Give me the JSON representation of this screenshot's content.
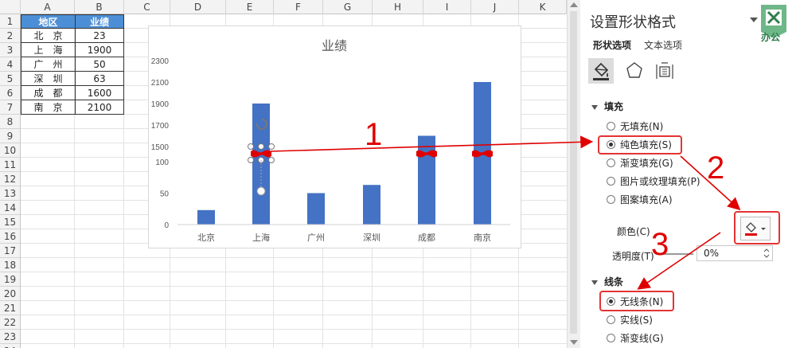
{
  "sheet": {
    "columns": [
      "A",
      "B",
      "C",
      "D",
      "E",
      "F",
      "G",
      "H",
      "I",
      "J",
      "K"
    ],
    "rows": [
      "1",
      "2",
      "3",
      "4",
      "5",
      "6",
      "7",
      "8",
      "9",
      "10",
      "11",
      "12",
      "13",
      "14",
      "15",
      "16",
      "17",
      "18",
      "19",
      "20",
      "21",
      "22",
      "23",
      "24"
    ],
    "table": {
      "headers": [
        "地区",
        "业绩"
      ],
      "rows": [
        [
          "北　京",
          "23"
        ],
        [
          "上　海",
          "1900"
        ],
        [
          "广　州",
          "50"
        ],
        [
          "深　圳",
          "63"
        ],
        [
          "成　都",
          "1600"
        ],
        [
          "南　京",
          "2100"
        ]
      ]
    }
  },
  "chart_data": {
    "type": "bar",
    "title": "业绩",
    "categories": [
      "北京",
      "上海",
      "广州",
      "深圳",
      "成都",
      "南京"
    ],
    "values": [
      23,
      1900,
      50,
      63,
      1600,
      2100
    ],
    "ytick_labels_upper": [
      "1500",
      "1700",
      "1900",
      "2100",
      "2300"
    ],
    "ytick_labels_lower": [
      "0",
      "50",
      "100"
    ],
    "axis_break": "100-1500",
    "bar_color": "#4472c4",
    "break_marker_color": "#e00000",
    "grid": false
  },
  "panel": {
    "title": "设置形状格式",
    "tabs": [
      "形状选项",
      "文本选项"
    ],
    "fill_section": "填充",
    "fill_options": [
      "无填充(N)",
      "纯色填充(S)",
      "渐变填充(G)",
      "图片或纹理填充(P)",
      "图案填充(A)"
    ],
    "selected_fill": 1,
    "color_label": "颜色(C)",
    "transparency_label": "透明度(T)",
    "transparency_value": "0%",
    "line_section": "线条",
    "line_options": [
      "无线条(N)",
      "实线(S)",
      "渐变线(G)"
    ],
    "selected_line": 0,
    "accent_color": "#e53333",
    "watermark": "办公"
  },
  "annotations": {
    "step1": "1",
    "step2": "2",
    "step3": "3"
  }
}
